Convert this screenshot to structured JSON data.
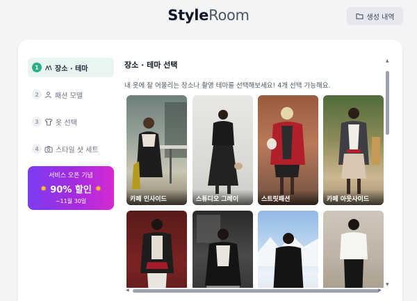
{
  "header": {
    "logo_bold": "Style",
    "logo_rest": "Room",
    "history_label": "생성 내역"
  },
  "sidebar": {
    "steps": [
      {
        "num": "1",
        "label": "장소 · 테마",
        "icon": "palette-icon"
      },
      {
        "num": "2",
        "label": "패션 모델",
        "icon": "person-icon"
      },
      {
        "num": "3",
        "label": "옷 선택",
        "icon": "shirt-icon"
      },
      {
        "num": "4",
        "label": "스타일 샷 세트",
        "icon": "camera-icon"
      }
    ]
  },
  "promo": {
    "line1": "서비스 오픈 기념",
    "line2": "90% 할인",
    "line3": "~11월 30일"
  },
  "main": {
    "title": "장소 · 테마 선택",
    "description": "내 옷에 잘 어울리는 장소나 촬영 테마를 선택해보세요! 4개 선택 가능해요.",
    "themes": [
      {
        "label": "카페 인사이드"
      },
      {
        "label": "스튜디오 그레이"
      },
      {
        "label": "스트릿패션"
      },
      {
        "label": "카페 아웃사이드"
      },
      {
        "label": ""
      },
      {
        "label": ""
      },
      {
        "label": ""
      },
      {
        "label": ""
      }
    ]
  },
  "colors": {
    "accent": "#2db08a",
    "active_bg": "#e9f5f1",
    "promo_start": "#7b3cf0",
    "promo_end": "#d42bd0"
  }
}
